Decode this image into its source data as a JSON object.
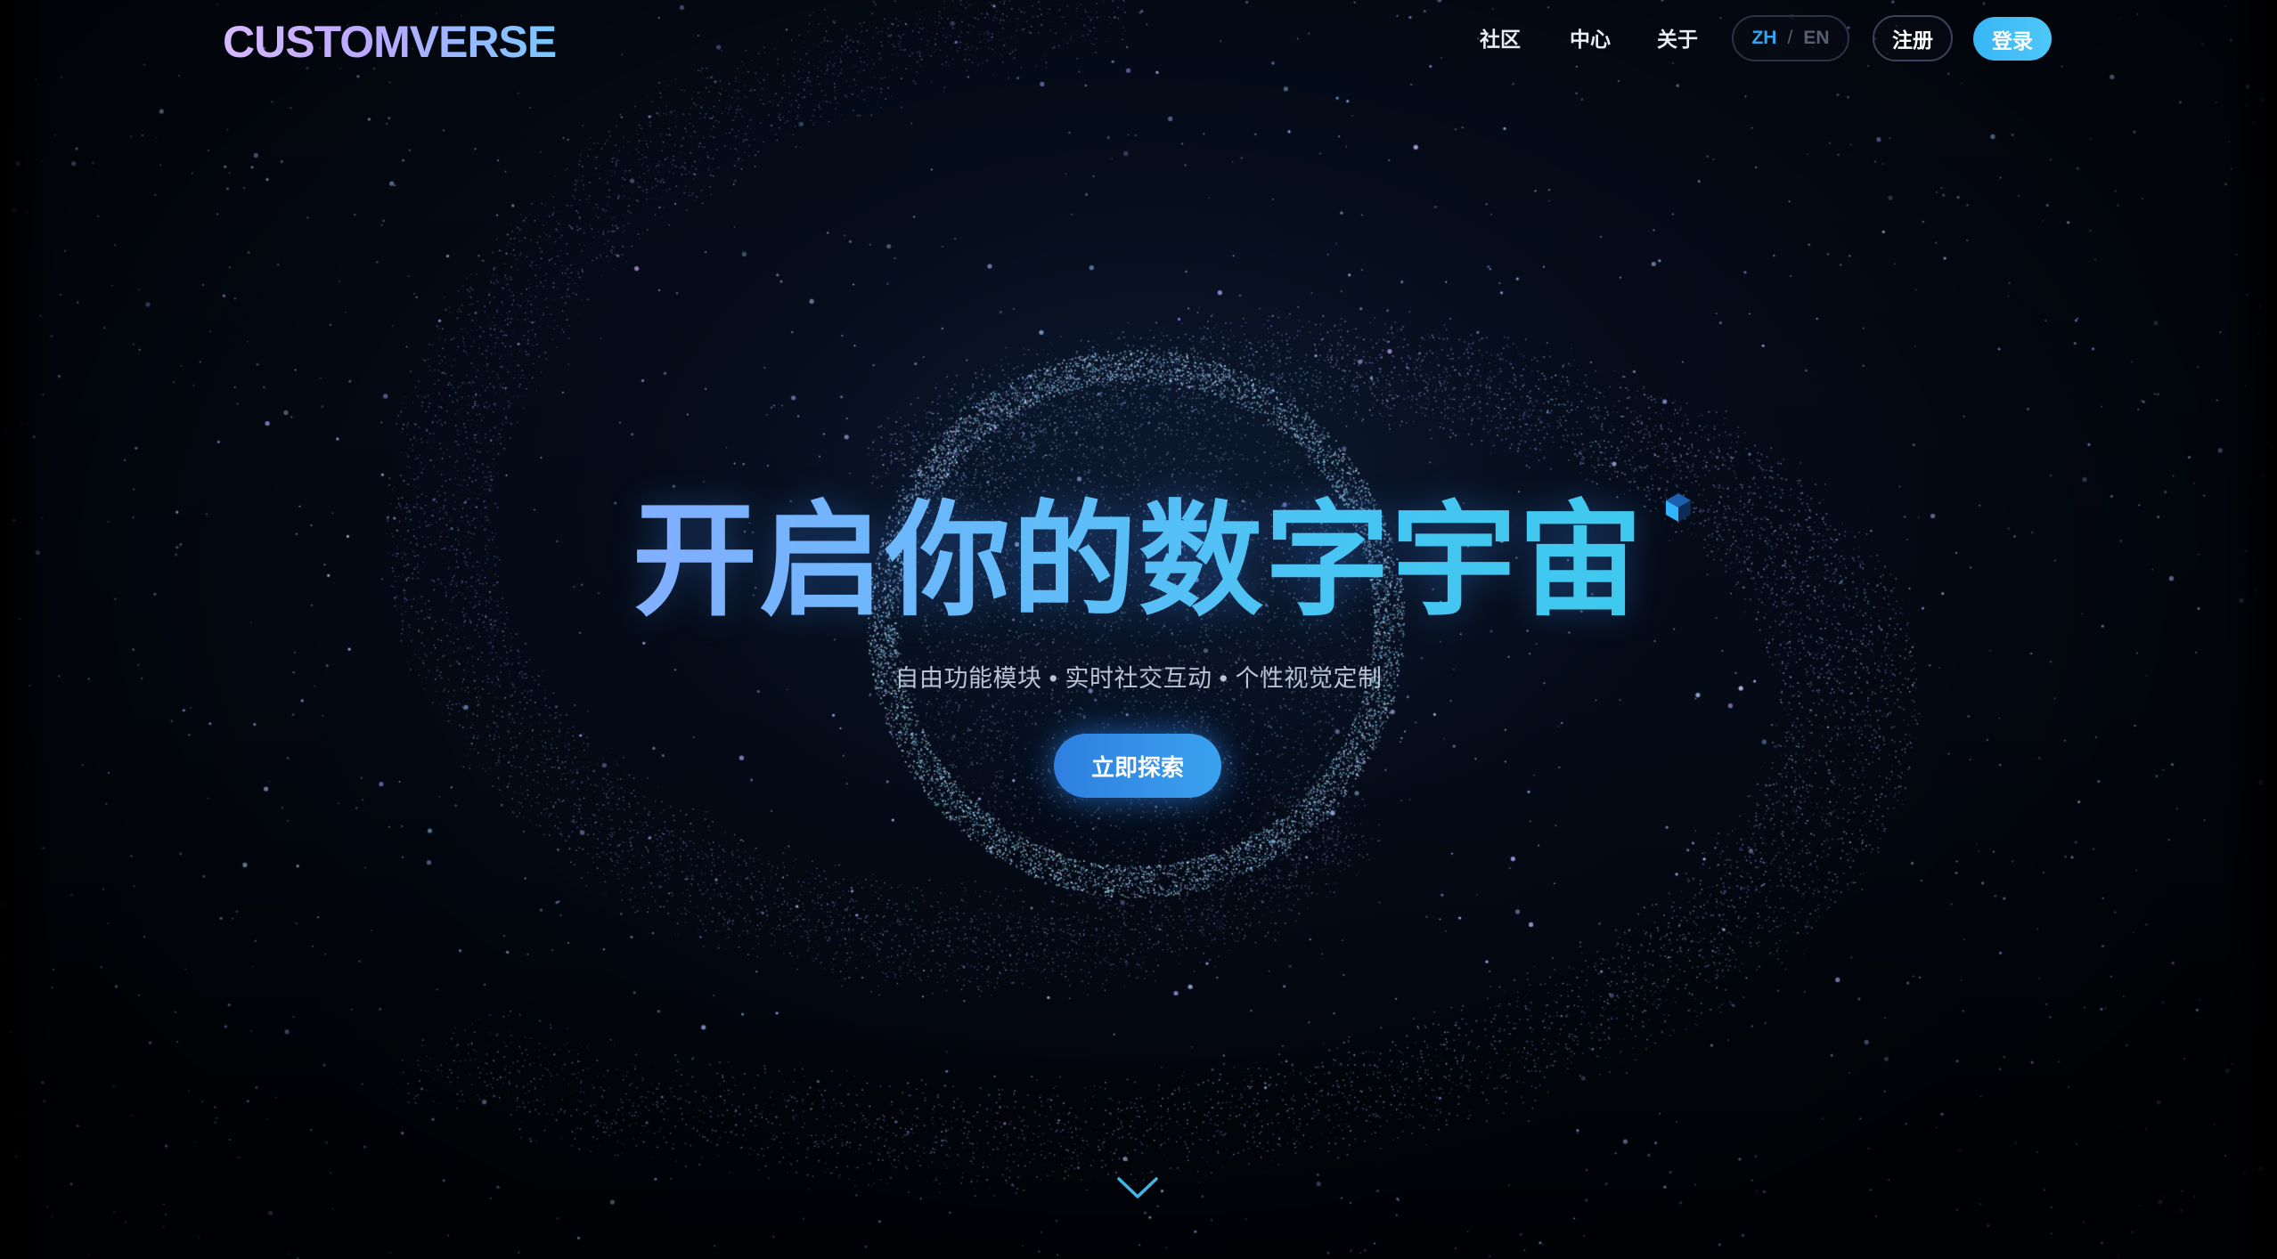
{
  "header": {
    "logo": "CUSTOMVERSE",
    "nav": [
      {
        "label": "社区"
      },
      {
        "label": "中心"
      },
      {
        "label": "关于"
      }
    ],
    "language": {
      "zh": "ZH",
      "separator": "/",
      "en": "EN",
      "active": "ZH"
    },
    "register_label": "注册",
    "login_label": "登录"
  },
  "hero": {
    "title": "开启你的数字宇宙",
    "subtitle": "自由功能模块 • 实时社交互动 • 个性视觉定制",
    "cta_label": "立即探索"
  },
  "icons": {
    "scroll_indicator": "chevron-down-icon",
    "cube": "cube-icon"
  },
  "colors": {
    "background": "#02040a",
    "accent": "#37b6f6",
    "title_start": "#9cb9ff",
    "title_end": "#2fd0e6",
    "particle": "#8fb8ff"
  }
}
